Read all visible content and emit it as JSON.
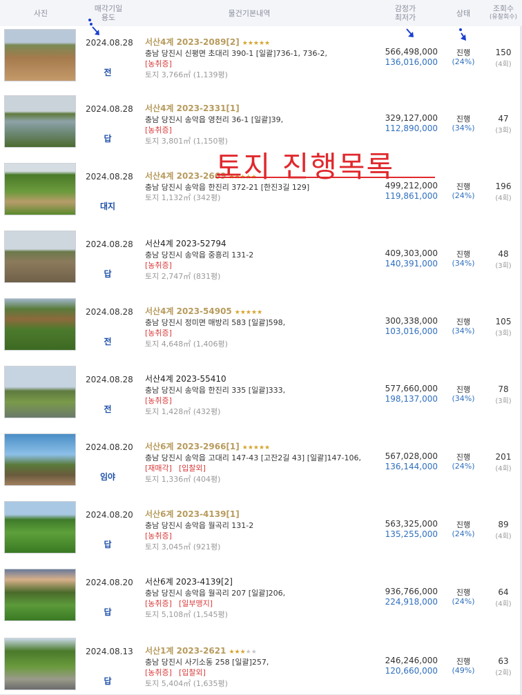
{
  "header": {
    "photo": "사진",
    "date_line1": "매각기일",
    "date_line2": "용도",
    "info": "물건기본내역",
    "price_line1": "감정가",
    "price_line2": "최저가",
    "status": "상태",
    "views_line1": "조회수",
    "views_line2": "(유찰회수)"
  },
  "overlay_text": "토지 진행목록",
  "rows": [
    {
      "date": "2024.08.28",
      "use": "전",
      "case": "서산4계 2023-2089[2]",
      "case_style": "gold",
      "stars": 5,
      "addr": "충남 당진시 신평면 초대리 390-1 [일괄]736-1, 736-2,",
      "tags": [
        "[농취증]"
      ],
      "land": "토지 3,766㎡ (1,139평)",
      "appraisal": "566,498,000",
      "minimum": "136,016,000",
      "status": "진행",
      "pct": "(24%)",
      "views": "150",
      "fails": "(4회)"
    },
    {
      "date": "2024.08.28",
      "use": "답",
      "case": "서산4계 2023-2331[1]",
      "case_style": "gold",
      "stars": 0,
      "addr": "충남 당진시 송악읍 영천리 36-1 [일괄]39,",
      "tags": [
        "[농취증]"
      ],
      "land": "토지 3,801㎡ (1,150평)",
      "appraisal": "329,127,000",
      "minimum": "112,890,000",
      "status": "진행",
      "pct": "(34%)",
      "views": "47",
      "fails": "(3회)"
    },
    {
      "date": "2024.08.28",
      "use": "대지",
      "case": "서산4계 2023-2669",
      "case_style": "gold",
      "stars": 5,
      "addr": "충남 당진시 송악읍 한진리 372-21 [한진3길 129]",
      "tags": [],
      "land": "토지 1,132㎡ (342평)",
      "appraisal": "499,212,000",
      "minimum": "119,861,000",
      "status": "진행",
      "pct": "(24%)",
      "views": "196",
      "fails": "(4회)"
    },
    {
      "date": "2024.08.28",
      "use": "답",
      "case": "서산4계 2023-52794",
      "case_style": "dark",
      "stars": 0,
      "addr": "충남 당진시 송악읍 중흥리 131-2",
      "tags": [
        "[농취증]"
      ],
      "land": "토지 2,747㎡ (831평)",
      "appraisal": "409,303,000",
      "minimum": "140,391,000",
      "status": "진행",
      "pct": "(34%)",
      "views": "48",
      "fails": "(3회)"
    },
    {
      "date": "2024.08.28",
      "use": "전",
      "case": "서산4계 2023-54905",
      "case_style": "gold",
      "stars": 5,
      "addr": "충남 당진시 정미면 매방리 583 [일괄]598,",
      "tags": [
        "[농취증]"
      ],
      "land": "토지 4,648㎡ (1,406평)",
      "appraisal": "300,338,000",
      "minimum": "103,016,000",
      "status": "진행",
      "pct": "(34%)",
      "views": "105",
      "fails": "(3회)"
    },
    {
      "date": "2024.08.28",
      "use": "전",
      "case": "서산4계 2023-55410",
      "case_style": "dark",
      "stars": 0,
      "addr": "충남 당진시 송악읍 한진리 335 [일괄]333,",
      "tags": [
        "[농취증]"
      ],
      "land": "토지 1,428㎡ (432평)",
      "appraisal": "577,660,000",
      "minimum": "198,137,000",
      "status": "진행",
      "pct": "(34%)",
      "views": "78",
      "fails": "(3회)"
    },
    {
      "date": "2024.08.20",
      "use": "임야",
      "case": "서산6계 2023-2966[1]",
      "case_style": "gold",
      "stars": 5,
      "addr": "충남 당진시 송악읍 고대리 147-43 [고잔2길 43] [일괄]147-106,",
      "tags": [
        "[재매각]",
        "[입찰외]"
      ],
      "land": "토지 1,336㎡ (404평)",
      "appraisal": "567,028,000",
      "minimum": "136,144,000",
      "status": "진행",
      "pct": "(24%)",
      "views": "201",
      "fails": "(4회)"
    },
    {
      "date": "2024.08.20",
      "use": "답",
      "case": "서산6계 2023-4139[1]",
      "case_style": "gold",
      "stars": 0,
      "addr": "충남 당진시 송악읍 월곡리 131-2",
      "tags": [
        "[농취증]"
      ],
      "land": "토지 3,045㎡ (921평)",
      "appraisal": "563,325,000",
      "minimum": "135,255,000",
      "status": "진행",
      "pct": "(24%)",
      "views": "89",
      "fails": "(4회)"
    },
    {
      "date": "2024.08.20",
      "use": "답",
      "case": "서산6계 2023-4139[2]",
      "case_style": "dark",
      "stars": 0,
      "addr": "충남 당진시 송악읍 월곡리 207 [일괄]206,",
      "tags": [
        "[농취증]",
        "[일부맹지]"
      ],
      "land": "토지 5,108㎡ (1,545평)",
      "appraisal": "936,766,000",
      "minimum": "224,918,000",
      "status": "진행",
      "pct": "(24%)",
      "views": "64",
      "fails": "(4회)"
    },
    {
      "date": "2024.08.13",
      "use": "답",
      "case": "서산1계 2023-2621",
      "case_style": "gold",
      "stars": 3,
      "addr": "충남 당진시 사기소동 258 [일괄]257,",
      "tags": [
        "[농취증]",
        "[입찰외]"
      ],
      "land": "토지 5,404㎡ (1,635평)",
      "appraisal": "246,246,000",
      "minimum": "120,660,000",
      "status": "진행",
      "pct": "(49%)",
      "views": "63",
      "fails": "(2회)"
    }
  ]
}
